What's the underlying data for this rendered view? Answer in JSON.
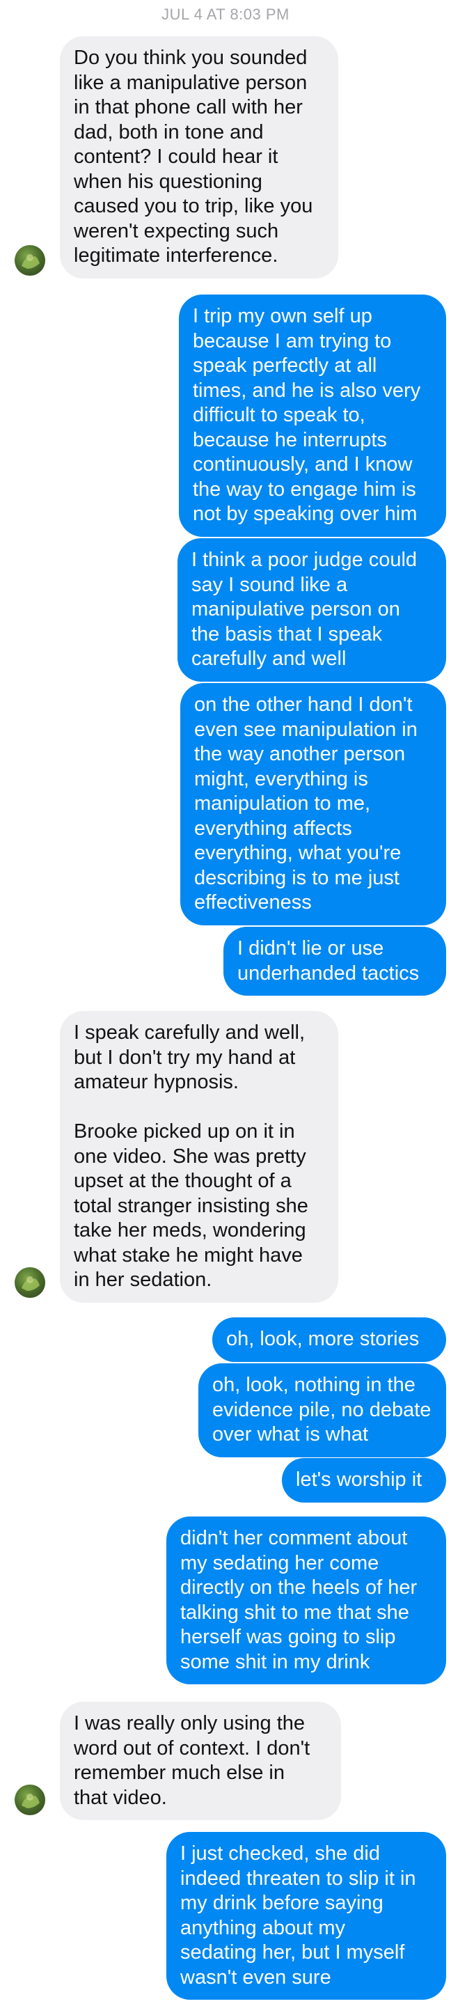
{
  "thread": {
    "timestamp": "JUL 4 AT 8:03 PM",
    "avatar_icon": "contact-avatar-icon",
    "colors": {
      "incoming_bubble": "#efeff2",
      "outgoing_bubble": "#0288f2",
      "timestamp_text": "#a6a6ab"
    },
    "messages": [
      {
        "direction": "incoming",
        "text": "Do you think you sounded\nlike a manipulative person\nin that phone call with her\ndad, both in tone and\ncontent? I could hear it\nwhen his questioning\ncaused you to trip, like you\nweren't expecting such\nlegitimate interference."
      },
      {
        "direction": "outgoing",
        "text": "I trip my own self up\nbecause I am trying to\nspeak perfectly at all\ntimes, and he is also very\ndifficult to speak to,\nbecause he interrupts\ncontinuously, and I know\nthe way to engage him is\nnot by speaking over him"
      },
      {
        "direction": "outgoing",
        "text": "I think a poor judge could\nsay I sound like a\nmanipulative person on\nthe basis that I speak\ncarefully and well"
      },
      {
        "direction": "outgoing",
        "text": "on the other hand I don't\neven see manipulation in\nthe way another person\nmight, everything is\nmanipulation to me,\neverything affects\neverything, what you're\ndescribing is to me just\neffectiveness"
      },
      {
        "direction": "outgoing",
        "text": "I didn't lie or use\nunderhanded tactics"
      },
      {
        "direction": "incoming",
        "text": "I speak carefully and well,\nbut I don't try my hand at\namateur hypnosis.\n\nBrooke picked up on it in\none video. She was pretty\nupset at the thought of a\ntotal stranger insisting she\ntake her meds, wondering\nwhat stake he might have\nin her sedation."
      },
      {
        "direction": "outgoing",
        "text": "oh, look, more stories"
      },
      {
        "direction": "outgoing",
        "text": "oh, look, nothing in the\nevidence pile, no debate\nover what is what"
      },
      {
        "direction": "outgoing",
        "text": "let's worship it"
      },
      {
        "direction": "outgoing",
        "text": "didn't her comment about\nmy sedating her come\ndirectly on the heels of her\ntalking shit to me that she\nherself was going to slip\nsome shit in my drink"
      },
      {
        "direction": "incoming",
        "text": "I was really only using the\nword out of context. I don't\nremember much else in\nthat video."
      },
      {
        "direction": "outgoing",
        "text": "I just checked, she did\nindeed threaten to slip it in\nmy drink before saying\nanything about my\nsedating her, but I myself\nwasn't even sure"
      }
    ]
  }
}
